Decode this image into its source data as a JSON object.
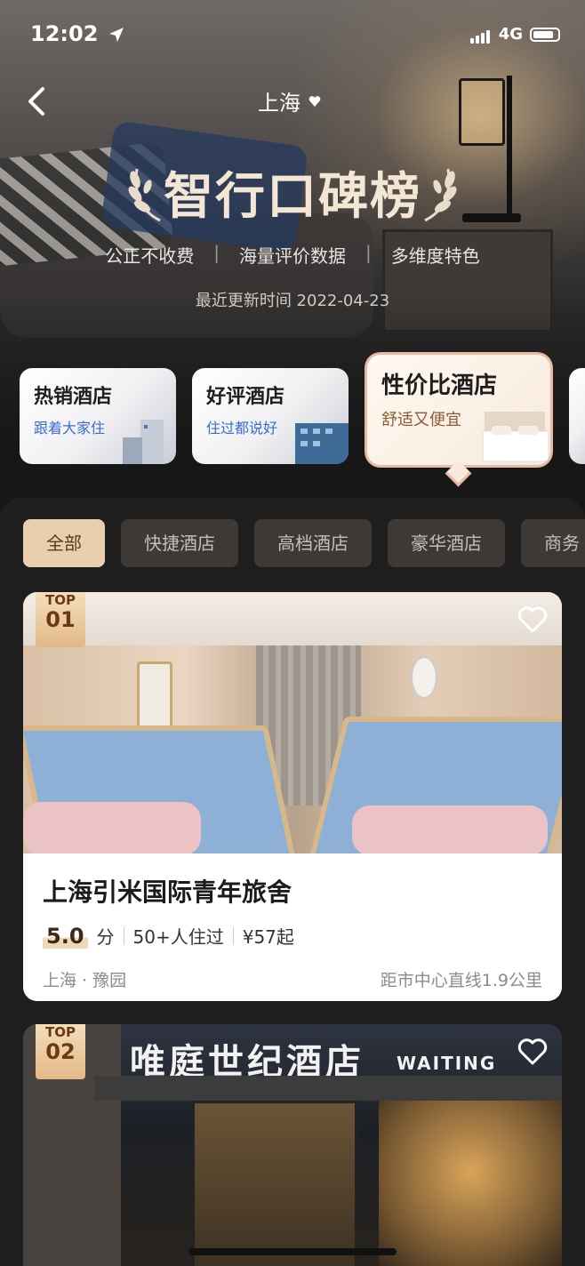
{
  "status": {
    "time": "12:02",
    "network": "4G"
  },
  "header": {
    "city": "上海",
    "title": "智行口碑榜",
    "tags": [
      "公正不收费",
      "海量评价数据",
      "多维度特色"
    ],
    "update": "最近更新时间 2022-04-23"
  },
  "categories": [
    {
      "title": "热销酒店",
      "sub": "跟着大家住"
    },
    {
      "title": "好评酒店",
      "sub": "住过都说好"
    },
    {
      "title": "性价比酒店",
      "sub": "舒适又便宜"
    }
  ],
  "filters": [
    "全部",
    "快捷酒店",
    "高档酒店",
    "豪华酒店",
    "商务"
  ],
  "hotels": [
    {
      "rank_label": "TOP",
      "rank": "01",
      "name": "上海引米国际青年旅舍",
      "score": "5.0",
      "score_unit": "分",
      "stayed": "50+人住过",
      "price": "¥57起",
      "location": "上海 · 豫园",
      "distance": "距市中心直线1.9公里"
    },
    {
      "rank_label": "TOP",
      "rank": "02",
      "sign_cn": "唯庭世纪酒店",
      "sign_en": "WAITING HOTEL"
    }
  ],
  "icons": {
    "back": "chevron-left-icon",
    "favorite": "heart-icon",
    "location_arrow": "location-arrow-icon"
  }
}
